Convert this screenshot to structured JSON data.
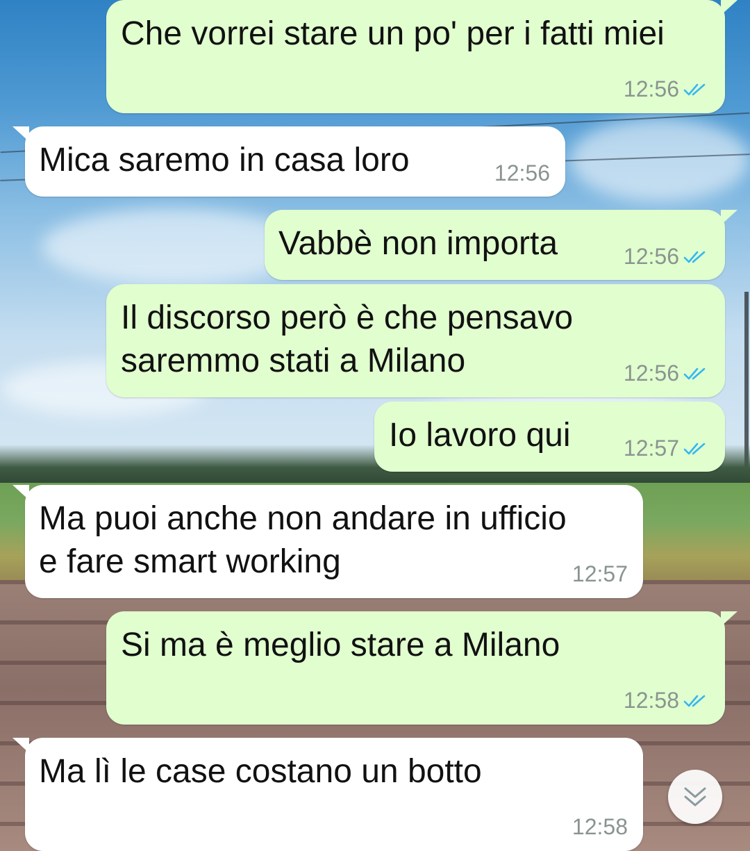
{
  "messages": [
    {
      "direction": "outgoing",
      "text": "Che vorrei stare un po' per i fatti miei",
      "time": "12:56",
      "status": "read"
    },
    {
      "direction": "incoming",
      "text": "Mica saremo in casa loro",
      "time": "12:56"
    },
    {
      "direction": "outgoing",
      "text": "Vabbè non importa",
      "time": "12:56",
      "status": "read"
    },
    {
      "direction": "outgoing",
      "text": "Il discorso però è che pensavo\nsaremmo stati a Milano",
      "time": "12:56",
      "status": "read"
    },
    {
      "direction": "outgoing",
      "text": "Io lavoro qui",
      "time": "12:57",
      "status": "read"
    },
    {
      "direction": "incoming",
      "text": "Ma puoi anche non andare in ufficio\ne fare smart working",
      "time": "12:57"
    },
    {
      "direction": "outgoing",
      "text": "Si ma è meglio stare a Milano",
      "time": "12:58",
      "status": "read"
    },
    {
      "direction": "incoming",
      "text": "Ma lì le case costano un botto",
      "time": "12:58"
    }
  ],
  "icons": {
    "read_receipt": "double-check-icon",
    "scroll_down": "double-chevron-down-icon"
  },
  "colors": {
    "outgoing_bubble": "#e1fecf",
    "incoming_bubble": "#ffffff",
    "read_check": "#34b7f1",
    "timestamp": "#8a948f"
  }
}
